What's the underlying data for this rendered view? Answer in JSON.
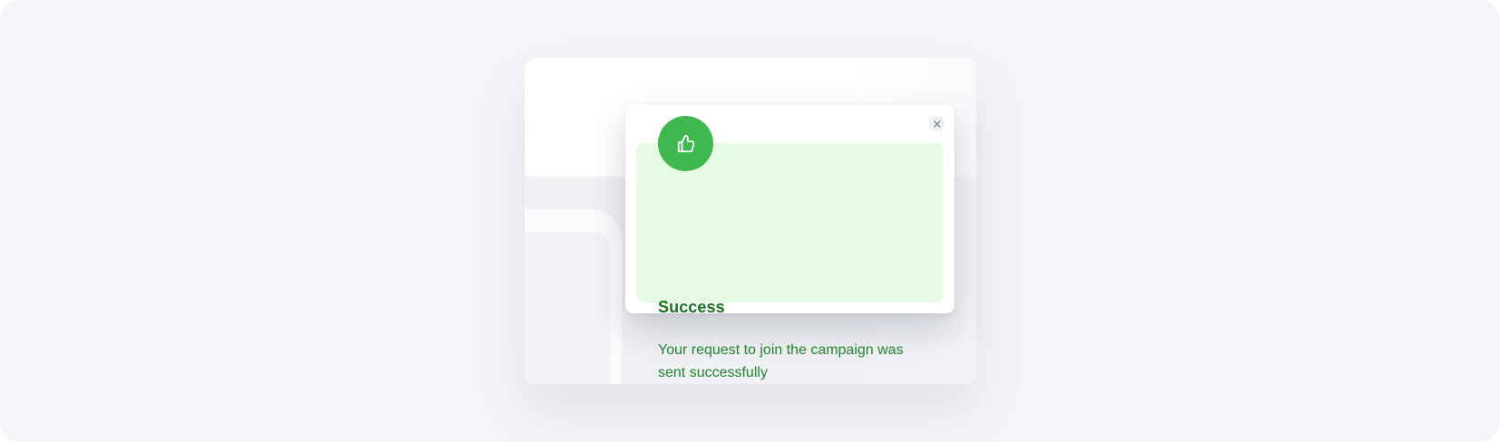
{
  "backdrop": {
    "description_free": true
  },
  "modal": {
    "close_icon": "close-icon",
    "badge_icon": "thumbs-up-icon",
    "title": "Success",
    "message": "Your request to join the campaign was sent successfully",
    "colors": {
      "badge": "#3fb84f",
      "alert_background": "#e6fbe4",
      "title": "#17731f",
      "message": "#22852c"
    }
  }
}
